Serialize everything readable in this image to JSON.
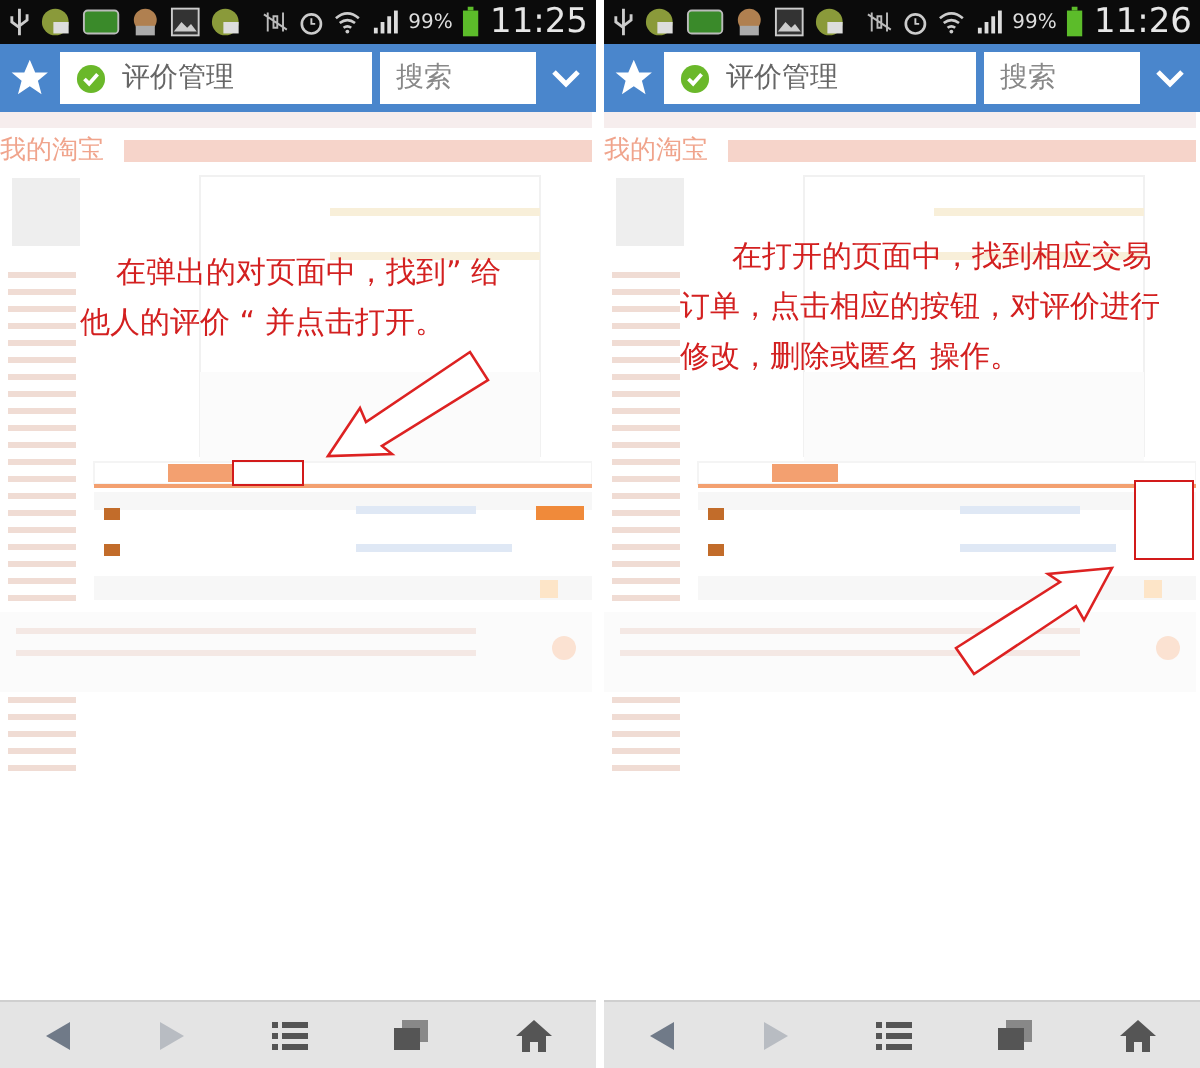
{
  "panels": [
    {
      "status_bar": {
        "battery": "99%",
        "time": "11:25"
      },
      "address_bar": {
        "value": "评价管理"
      },
      "search_field": {
        "placeholder": "搜索"
      },
      "page": {
        "logo": "我的淘宝",
        "highlight": {
          "kind": "tab"
        }
      },
      "annotation": {
        "lines": [
          "在弹出的对页面中，找到” 给",
          "他人的评价 “ 并点击打开。"
        ],
        "arrow": {
          "kind": "downleft"
        }
      }
    },
    {
      "status_bar": {
        "battery": "99%",
        "time": "11:26"
      },
      "address_bar": {
        "value": "评价管理"
      },
      "search_field": {
        "placeholder": "搜索"
      },
      "page": {
        "logo": "我的淘宝",
        "highlight": {
          "kind": "actions"
        }
      },
      "annotation": {
        "lines": [
          "在打开的页面中，找到相应交易",
          "订单，点击相应的按钮，对评价进行",
          "修改，删除或匿名 操作。"
        ],
        "arrow": {
          "kind": "upright"
        }
      }
    }
  ]
}
